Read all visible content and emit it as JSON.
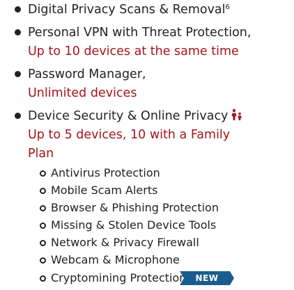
{
  "features": [
    {
      "label": "Digital Privacy Scans & Removal",
      "footnote": "6"
    },
    {
      "label": "Personal VPN with Threat Protection,",
      "detail": "Up to 10 devices at the same time"
    },
    {
      "label": "Password Manager,",
      "detail": "Unlimited devices"
    },
    {
      "label": "Device Security & Online Privacy",
      "icon": "family-icon",
      "detail_line1": "Up to 5 devices, 10 with a Family",
      "detail_line2": "Plan",
      "subfeatures": [
        "Antivirus Protection",
        "Mobile Scam Alerts",
        "Browser & Phishing Protection",
        "Missing & Stolen Device Tools",
        "Network & Privacy Firewall",
        "Webcam & Microphone",
        "Cryptomining Protection"
      ],
      "new_badge": "NEW"
    }
  ],
  "colors": {
    "text": "#222222",
    "accent_red": "#a4161a",
    "badge_blue": "#1c5d8f",
    "badge_text": "#ffffff"
  }
}
